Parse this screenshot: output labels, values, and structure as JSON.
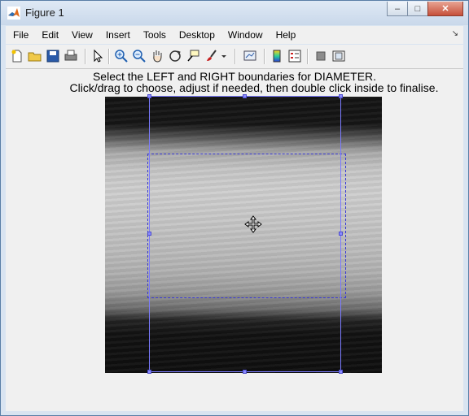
{
  "window": {
    "title": "Figure 1",
    "controls": {
      "minimize": "–",
      "maximize": "□",
      "close": "✕"
    }
  },
  "menu": {
    "items": [
      "File",
      "Edit",
      "View",
      "Insert",
      "Tools",
      "Desktop",
      "Window",
      "Help"
    ],
    "overflow_arrow": "↘"
  },
  "toolbar": {
    "buttons": [
      "new-figure-icon",
      "open-file-icon",
      "save-icon",
      "print-icon",
      "pointer-arrow-icon",
      "zoom-in-icon",
      "zoom-out-icon",
      "pan-hand-icon",
      "rotate-3d-icon",
      "data-cursor-icon",
      "brush-icon",
      "brush-dropdown-icon",
      "link-plot-icon",
      "colorbar-icon",
      "legend-icon",
      "hide-plot-tools-icon",
      "show-plot-tools-icon"
    ]
  },
  "instructions": {
    "line1": "Select the LEFT and RIGHT boundaries for DIAMETER.",
    "line2": "Click/drag to choose, adjust if needed, then double click inside to finalise."
  },
  "colors": {
    "roi_rect": "#7b7bff",
    "roi_dashed": "#3a3ad6",
    "matlab_orange": "#e26a1a"
  }
}
